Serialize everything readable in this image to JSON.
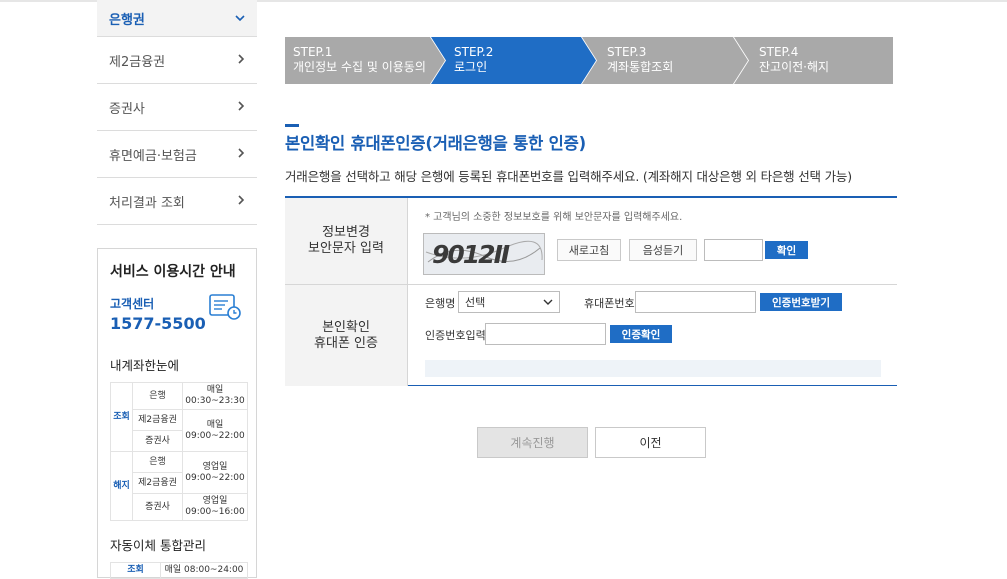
{
  "sidebar": {
    "items": [
      {
        "label": "은행권",
        "active": true
      },
      {
        "label": "제2금융권"
      },
      {
        "label": "증권사"
      },
      {
        "label": "휴면예금·보험금"
      },
      {
        "label": "처리결과 조회"
      }
    ]
  },
  "service": {
    "title": "서비스 이용시간 안내",
    "cc_label": "고객센터",
    "cc_number": "1577-5500",
    "account_heading": "내계좌한눈에",
    "rows": [
      {
        "group": "조회",
        "bank": "은행",
        "time": "매일 00:30~23:30"
      },
      {
        "bank": "제2금융권",
        "time": "매일 09:00~22:00"
      },
      {
        "bank": "증권사"
      },
      {
        "group": "해지",
        "bank": "은행",
        "time": "영업일 09:00~22:00"
      },
      {
        "bank": "제2금융권"
      },
      {
        "bank": "증권사",
        "time": "영업일 09:00~16:00"
      }
    ],
    "auto_heading": "자동이체 통합관리",
    "auto_row": {
      "group": "조회",
      "time": "매일 08:00~24:00"
    }
  },
  "steps": [
    {
      "no": "STEP.1",
      "name": "개인정보 수집 및 이용동의",
      "state": "done"
    },
    {
      "no": "STEP.2",
      "name": "로그인",
      "state": "current"
    },
    {
      "no": "STEP.3",
      "name": "계좌통합조회",
      "state": "todo"
    },
    {
      "no": "STEP.4",
      "name": "잔고이전·해지",
      "state": "todo"
    }
  ],
  "page": {
    "title": "본인확인 휴대폰인증(거래은행을 통한 인증)",
    "description": "거래은행을 선택하고 해당 은행에 등록된 휴대폰번호를 입력해주세요. (계좌해지 대상은행 외 타은행 선택 가능)"
  },
  "captcha_row": {
    "header_line1": "정보변경",
    "header_line2": "보안문자 입력",
    "note": "* 고객님의 소중한 정보보호를 위해 보안문자를 입력해주세요.",
    "captcha_text": "9012Ⅱ",
    "refresh_label": "새로고침",
    "audio_label": "음성듣기",
    "input_value": "",
    "confirm_label": "확인"
  },
  "auth_row": {
    "header_line1": "본인확인",
    "header_line2": "휴대폰 인증",
    "bank_label": "은행명",
    "bank_selected": "선택",
    "phone_label": "휴대폰번호",
    "phone_value": "",
    "request_label": "인증번호받기",
    "code_label": "인증번호입력",
    "code_value": "",
    "verify_label": "인증확인"
  },
  "buttons": {
    "continue_label": "계속진행",
    "prev_label": "이전"
  },
  "colors": {
    "accent": "#1a5fb4",
    "step_current": "#1f6dc5",
    "step_other": "#a9a9a9"
  }
}
